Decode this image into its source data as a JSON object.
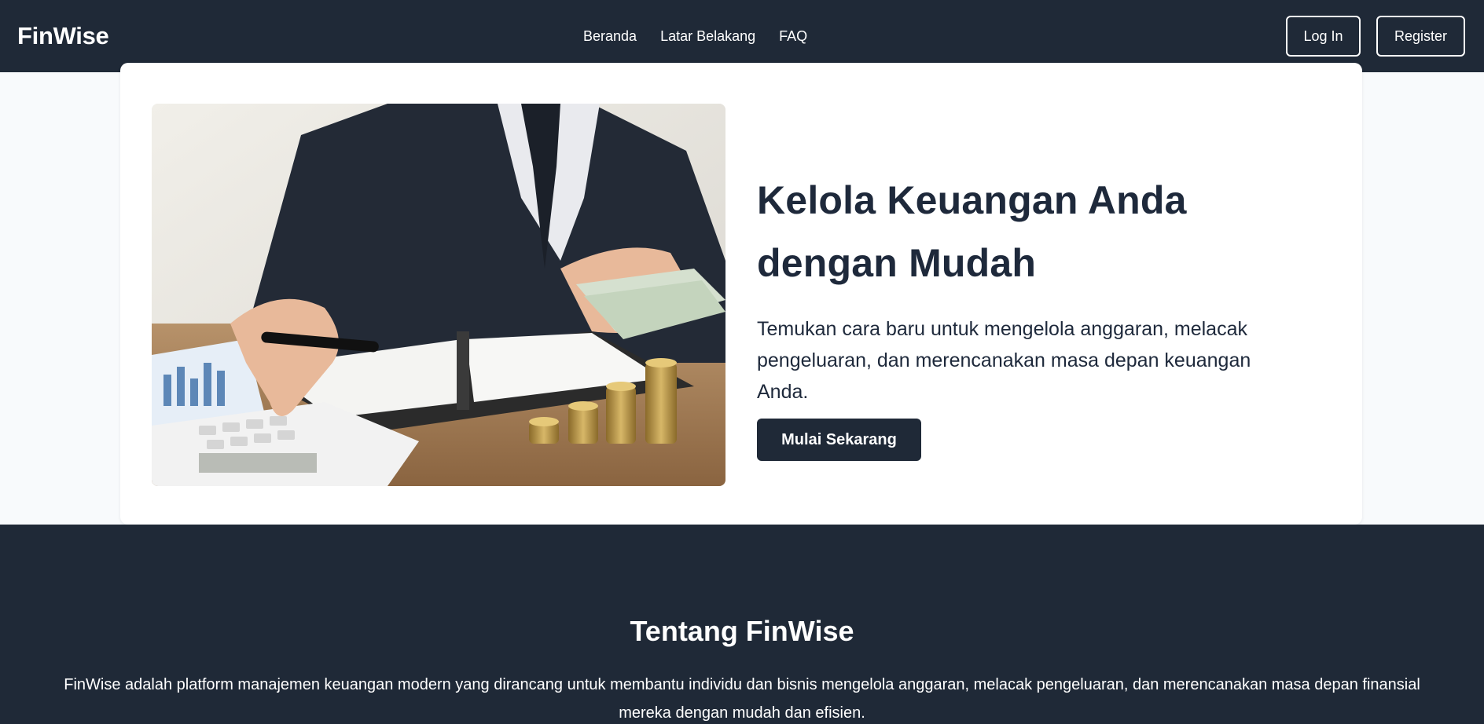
{
  "header": {
    "brand": "FinWise",
    "nav": [
      "Beranda",
      "Latar Belakang",
      "FAQ"
    ],
    "login_label": "Log In",
    "register_label": "Register"
  },
  "hero": {
    "title": "Kelola Keuangan Anda dengan Mudah",
    "description": "Temukan cara baru untuk mengelola anggaran, melacak pengeluaran, dan merencanakan masa depan keuangan Anda.",
    "cta_label": "Mulai Sekarang",
    "image_icon": "finance-photo-businessman-calculator-coins"
  },
  "about": {
    "title": "Tentang FinWise",
    "text": "FinWise adalah platform manajemen keuangan modern yang dirancang untuk membantu individu dan bisnis mengelola anggaran, melacak pengeluaran, dan merencanakan masa depan finansial mereka dengan mudah dan efisien."
  },
  "colors": {
    "navy": "#1f2937",
    "page_bg": "#f8fafc",
    "card_bg": "#ffffff",
    "text_dark": "#1e293b"
  }
}
